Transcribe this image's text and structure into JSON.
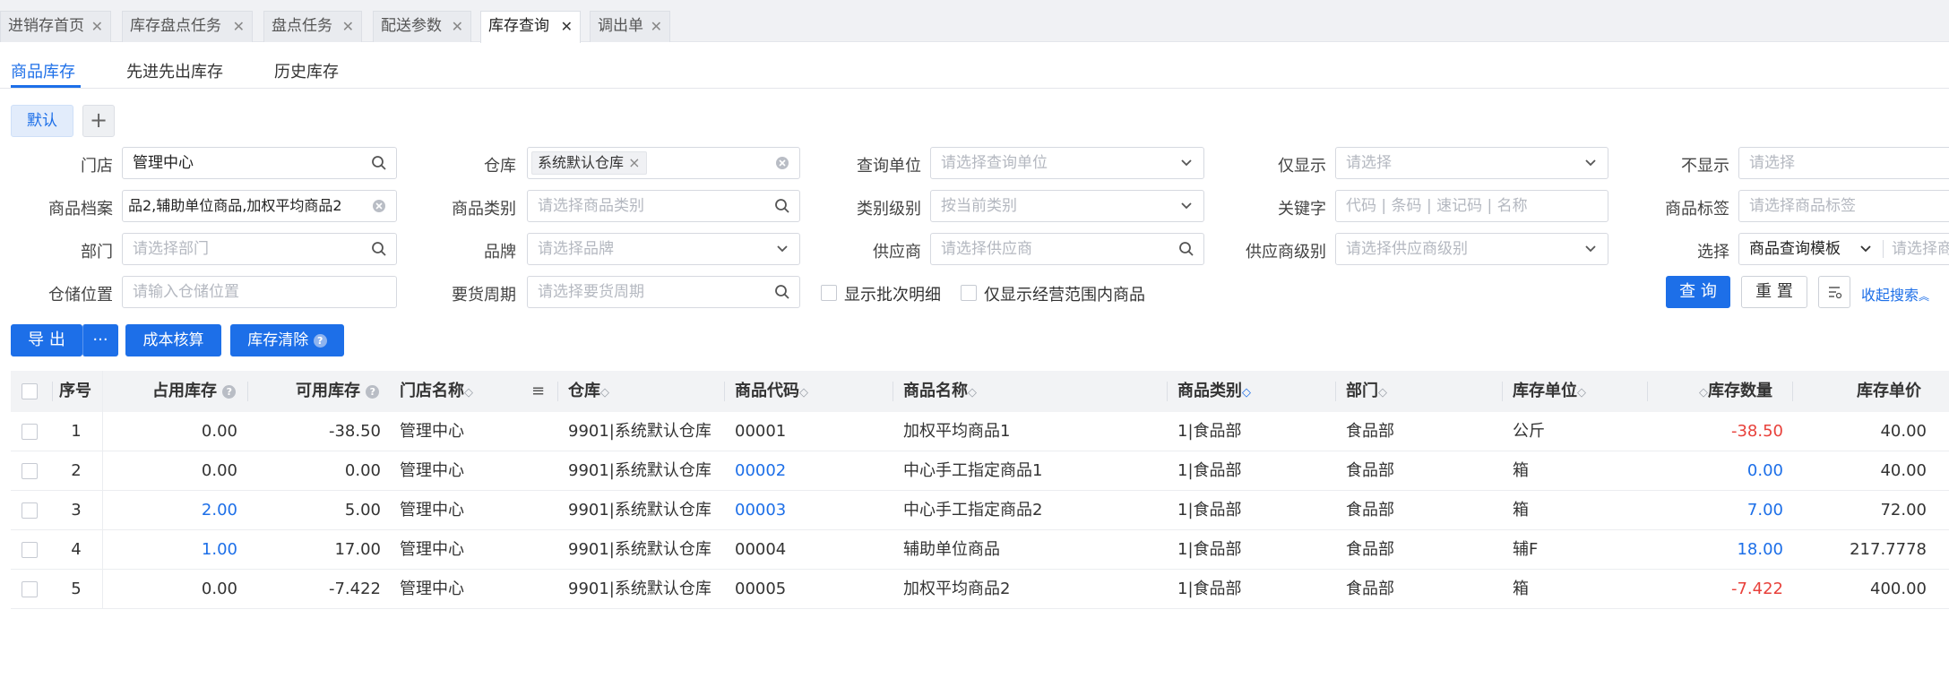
{
  "tabs": [
    {
      "label": "进销存首页",
      "close": "✕"
    },
    {
      "label": "库存盘点任务",
      "close": "✕"
    },
    {
      "label": "盘点任务",
      "close": "✕"
    },
    {
      "label": "配送参数",
      "close": "✕"
    },
    {
      "label": "库存查询",
      "close": "✕"
    },
    {
      "label": "调出单",
      "close": "✕"
    }
  ],
  "sub_tabs": [
    "商品库存",
    "先进先出库存",
    "历史库存"
  ],
  "views": {
    "default": "默认",
    "add": "+"
  },
  "filters": {
    "store_label": "门店",
    "store_value": "管理中心",
    "warehouse_label": "仓库",
    "warehouse_tag": "系统默认仓库",
    "query_unit_label": "查询单位",
    "query_unit_ph": "请选择查询单位",
    "only_show_label": "仅显示",
    "only_show_ph": "请选择",
    "hide_label": "不显示",
    "hide_ph": "请选择",
    "product_label": "商品档案",
    "product_value": "品2,辅助单位商品,加权平均商品2",
    "category_label": "商品类别",
    "category_ph": "请选择商品类别",
    "category_level_label": "类别级别",
    "category_level_ph": "按当前类别",
    "keyword_label": "关键字",
    "keyword_ph": "代码 | 条码 | 速记码 | 名称",
    "product_tag_label": "商品标签",
    "product_tag_ph": "请选择商品标签",
    "dept_label": "部门",
    "dept_ph": "请选择部门",
    "brand_label": "品牌",
    "brand_ph": "请选择品牌",
    "supplier_label": "供应商",
    "supplier_ph": "请选择供应商",
    "supplier_level_label": "供应商级别",
    "supplier_level_ph": "请选择供应商级别",
    "select_label": "选择",
    "select_value": "商品查询模板",
    "select_extra_ph": "请选择商",
    "location_label": "仓储位置",
    "location_ph": "请输入仓储位置",
    "cycle_label": "要货周期",
    "cycle_ph": "请选择要货周期",
    "cb_batch": "显示批次明细",
    "cb_scope": "仅显示经营范围内商品"
  },
  "actions": {
    "query": "查 询",
    "reset": "重 置",
    "collapse": "收起搜索",
    "export": "导 出",
    "more": "···",
    "cost": "成本核算",
    "clear": "库存清除"
  },
  "table": {
    "headers": [
      "序号",
      "占用库存",
      "可用库存",
      "门店名称",
      "仓库",
      "商品代码",
      "商品名称",
      "商品类别",
      "部门",
      "库存单位",
      "库存数量",
      "库存单价"
    ],
    "rows": [
      [
        "1",
        "0.00",
        "-38.50",
        "管理中心",
        "9901|系统默认仓库",
        "00001",
        "加权平均商品1",
        "1|食品部",
        "食品部",
        "公斤",
        "-38.50",
        "40.00"
      ],
      [
        "2",
        "0.00",
        "0.00",
        "管理中心",
        "9901|系统默认仓库",
        "00002",
        "中心手工指定商品1",
        "1|食品部",
        "食品部",
        "箱",
        "0.00",
        "40.00"
      ],
      [
        "3",
        "2.00",
        "5.00",
        "管理中心",
        "9901|系统默认仓库",
        "00003",
        "中心手工指定商品2",
        "1|食品部",
        "食品部",
        "箱",
        "7.00",
        "72.00"
      ],
      [
        "4",
        "1.00",
        "17.00",
        "管理中心",
        "9901|系统默认仓库",
        "00004",
        "辅助单位商品",
        "1|食品部",
        "食品部",
        "辅F",
        "18.00",
        "217.7778"
      ],
      [
        "5",
        "0.00",
        "-7.422",
        "管理中心",
        "9901|系统默认仓库",
        "00005",
        "加权平均商品2",
        "1|食品部",
        "食品部",
        "箱",
        "-7.422",
        "400.00"
      ]
    ]
  },
  "colors": {
    "accent": "#1d6fe8",
    "negative": "#e8413b"
  }
}
